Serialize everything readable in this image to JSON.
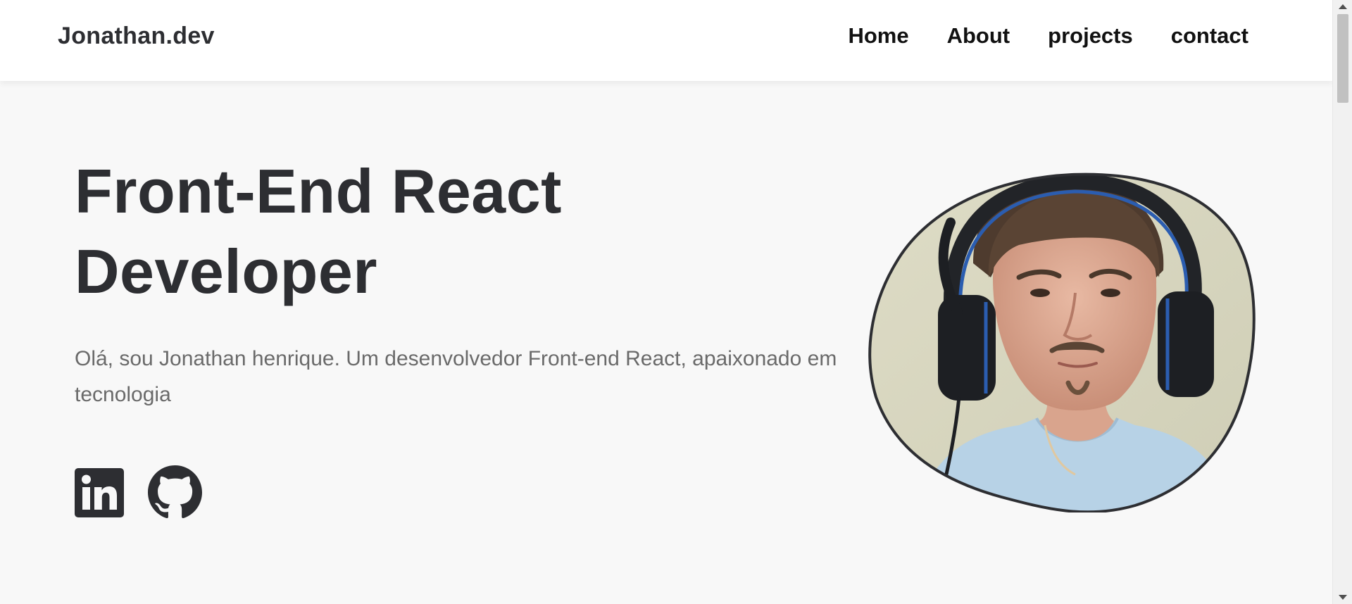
{
  "header": {
    "logo": "Jonathan.dev",
    "nav": [
      {
        "label": "Home"
      },
      {
        "label": "About"
      },
      {
        "label": "projects"
      },
      {
        "label": "contact"
      }
    ]
  },
  "hero": {
    "title_line1": "Front-End React",
    "title_line2": "Developer",
    "description": "Olá, sou Jonathan henrique. Um desenvolvedor Front-end React, apaixonado em tecnologia",
    "socials": [
      {
        "icon": "linkedin-icon"
      },
      {
        "icon": "github-icon"
      }
    ],
    "portrait": {
      "shape": "blob",
      "description": "profile photo"
    }
  },
  "colors": {
    "background": "#f8f8f8",
    "header_background": "#ffffff",
    "title": "#2d2e32",
    "description": "#6a6a6a",
    "icon": "#2d2e32"
  }
}
